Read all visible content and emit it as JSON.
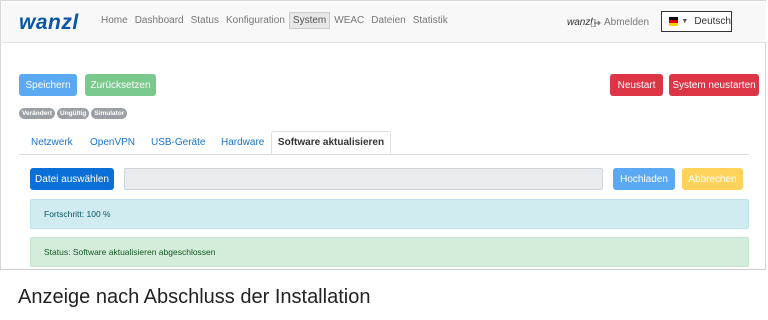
{
  "navbar": {
    "logo": "wanzl",
    "items": [
      {
        "label": "Home"
      },
      {
        "label": "Dashboard"
      },
      {
        "label": "Status"
      },
      {
        "label": "Konfiguration"
      },
      {
        "label": "System",
        "active": true
      },
      {
        "label": "WEAC"
      },
      {
        "label": "Dateien"
      },
      {
        "label": "Statistik"
      }
    ],
    "user": "wanzl",
    "logout_label": "Abmelden",
    "language": "Deutsch",
    "language_icon": "flag-de-icon"
  },
  "actions": {
    "save": "Speichern",
    "reset": "Zurücksetzen",
    "restart": "Neustart",
    "system_restart": "System neustarten"
  },
  "badges": [
    "Verändert",
    "Ungültig",
    "Simulator"
  ],
  "tabs": [
    {
      "label": "Netzwerk"
    },
    {
      "label": "OpenVPN"
    },
    {
      "label": "USB-Geräte"
    },
    {
      "label": "Hardware"
    },
    {
      "label": "Software aktualisieren",
      "active": true
    }
  ],
  "upload": {
    "choose_label": "Datei auswählen",
    "file_value": "",
    "upload_label": "Hochladen",
    "cancel_label": "Abbrechen"
  },
  "progress": {
    "text": "Fortschritt: 100 %",
    "value": 100
  },
  "status": {
    "text": "Status: Software aktualisieren abgeschlossen"
  },
  "caption": "Anzeige nach Abschluss der Installation",
  "colors": {
    "brand": "#0b57a6",
    "primary": "#0a6fd6",
    "danger": "#dc3545",
    "success": "#78c98b",
    "warning": "#ffd35a",
    "info_bg": "#d1ecf1",
    "success_bg": "#d4edda"
  }
}
